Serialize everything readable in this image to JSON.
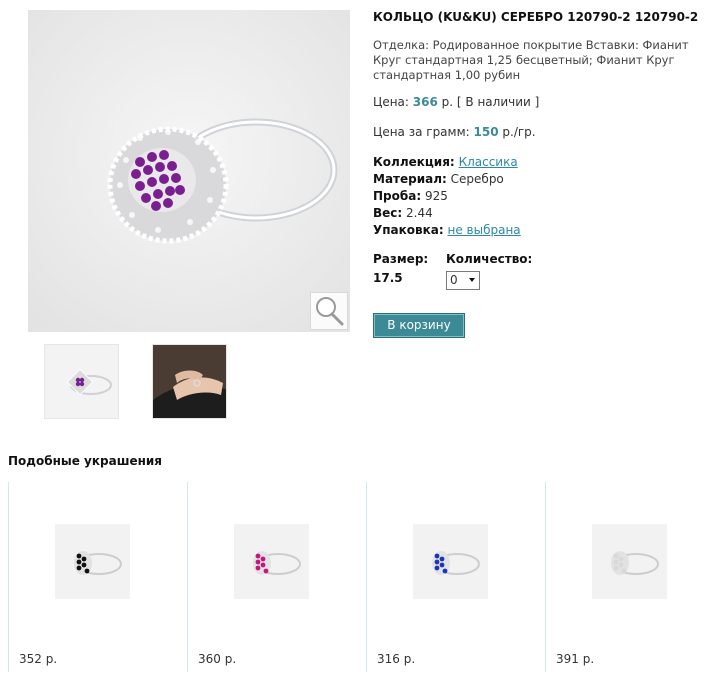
{
  "product": {
    "title": "КОЛЬЦО (KU&KU) СЕРЕБРО 120790-2 120790-2",
    "description": "Отделка: Родированное покрытие Вставки: Фианит Круг стандартная 1,25 бесцветный; Фианит Круг стандартная 1,00 рубин",
    "price_label": "Цена:",
    "price_value": "366",
    "price_suffix": "р. [ В наличии ]",
    "gram_label": "Цена за грамм:",
    "gram_value": "150",
    "gram_suffix": "р./гр.",
    "collection_label": "Коллекция:",
    "collection_value": "Классика",
    "material_label": "Материал:",
    "material_value": "Серебро",
    "proba_label": "Проба:",
    "proba_value": "925",
    "weight_label": "Вес:",
    "weight_value": "2.44",
    "pack_label": "Упаковка:",
    "pack_value": "не выбрана",
    "size_label": "Размер:",
    "size_value": "17.5",
    "qty_label": "Количество:",
    "qty_value": "0",
    "cart_button": "В корзину"
  },
  "similar": {
    "title": "Подобные украшения",
    "items": [
      {
        "price": "352 р.",
        "stone_color": "#111111"
      },
      {
        "price": "360 р.",
        "stone_color": "#c2187e"
      },
      {
        "price": "316 р.",
        "stone_color": "#1a35b8"
      },
      {
        "price": "391 р.",
        "stone_color": "#d9d9d9"
      }
    ]
  },
  "icons": {
    "zoom": "magnifier-icon",
    "select": "dropdown-caret-icon"
  },
  "colors": {
    "accent": "#3b8a96",
    "link": "#2a8aa8",
    "main_stone": "#7a1f8f"
  }
}
